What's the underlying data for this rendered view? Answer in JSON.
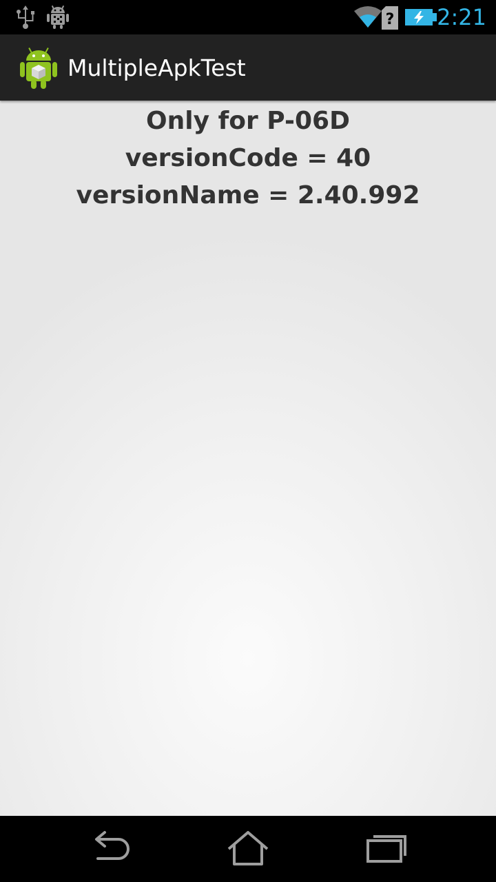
{
  "status_bar": {
    "time": "2:21",
    "icons": [
      "usb-icon",
      "debug-icon",
      "wifi-icon",
      "no-sim-icon",
      "battery-charging-icon"
    ],
    "accent_color": "#33b5e5"
  },
  "action_bar": {
    "title": "MultipleApkTest",
    "icon": "android-app-icon"
  },
  "content": {
    "lines": [
      "Only for P-06D",
      "versionCode = 40",
      "versionName = 2.40.992"
    ]
  },
  "nav_bar": {
    "buttons": [
      "back-icon",
      "home-icon",
      "recents-icon"
    ]
  }
}
